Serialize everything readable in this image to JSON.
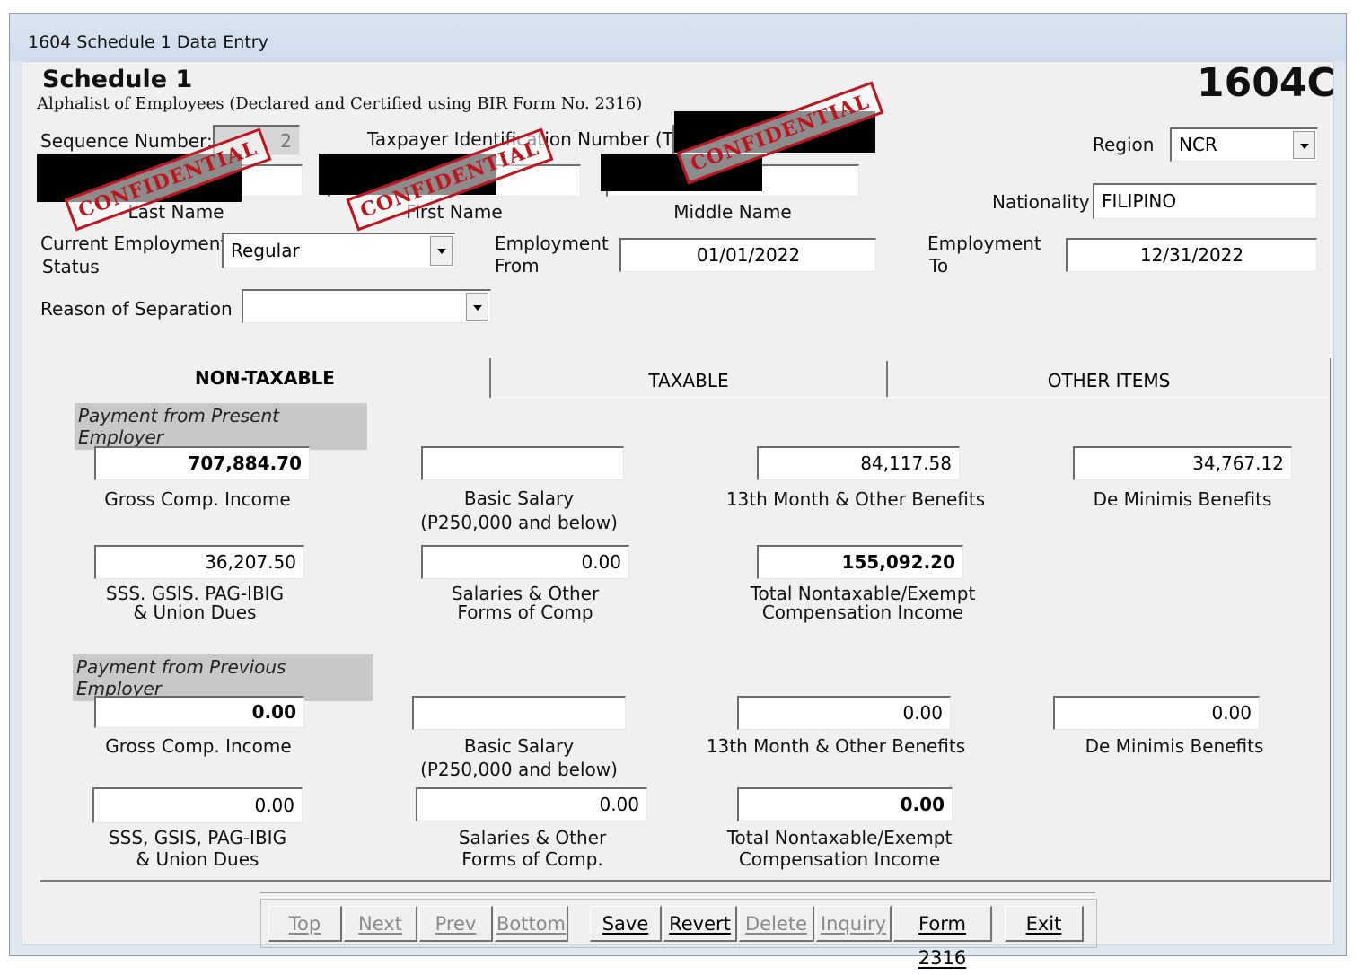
{
  "window": {
    "title": "1604 Schedule 1 Data Entry"
  },
  "header": {
    "title": "Schedule  1",
    "subtitle": "Alphalist of Employees (Declared and Certified using BIR Form No. 2316)",
    "form_code": "1604C"
  },
  "stamp_text": "CONFIDENTIAL",
  "fields": {
    "sequence_label": "Sequence Number:",
    "sequence_value": "2",
    "tin_label": "Taxpayer Identification Number (TIN):",
    "region_label": "Region",
    "region_value": "NCR",
    "nationality_label": "Nationality",
    "nationality_value": "FILIPINO",
    "last_name_label": "Last Name",
    "first_name_label": "First Name",
    "middle_name_label": "Middle Name",
    "employment_status_label_1": "Current Employment",
    "employment_status_label_2": "Status",
    "employment_status_value": "Regular",
    "employment_from_label_1": "Employment",
    "employment_from_label_2": "From",
    "employment_from_value": "01/01/2022",
    "employment_to_label_1": "Employment",
    "employment_to_label_2": "To",
    "employment_to_value": "12/31/2022",
    "reason_label": "Reason of Separation",
    "reason_value": ""
  },
  "tabs": [
    "NON-TAXABLE",
    "TAXABLE",
    "OTHER ITEMS"
  ],
  "present": {
    "section_title": "Payment from Present Employer",
    "gross_value": "707,884.70",
    "gross_label": "Gross Comp. Income",
    "basic_value": "",
    "basic_label_1": "Basic Salary",
    "basic_label_2": "(P250,000 and below)",
    "month13_value": "84,117.58",
    "month13_label": "13th Month &  Other Benefits",
    "deminimis_value": "34,767.12",
    "deminimis_label": "De Minimis Benefits",
    "sss_value": "36,207.50",
    "sss_label_1": "SSS. GSIS. PAG-IBIG",
    "sss_label_2": "& Union Dues",
    "salaries_value": "0.00",
    "salaries_label_1": "Salaries & Other",
    "salaries_label_2": "Forms of Comp",
    "total_value": "155,092.20",
    "total_label_1": "Total Nontaxable/Exempt",
    "total_label_2": "Compensation Income"
  },
  "previous": {
    "section_title": "Payment from Previous Employer",
    "gross_value": "0.00",
    "gross_label": "Gross Comp. Income",
    "basic_value": "",
    "basic_label_1": "Basic Salary",
    "basic_label_2": "(P250,000 and below)",
    "month13_value": "0.00",
    "month13_label": "13th Month &  Other Benefits",
    "deminimis_value": "0.00",
    "deminimis_label": "De Minimis Benefits",
    "sss_value": "0.00",
    "sss_label_1": "SSS, GSIS, PAG-IBIG",
    "sss_label_2": "& Union Dues",
    "salaries_value": "0.00",
    "salaries_label_1": "Salaries & Other",
    "salaries_label_2": "Forms of Comp.",
    "total_value": "0.00",
    "total_label_1": "Total Nontaxable/Exempt",
    "total_label_2": "Compensation Income"
  },
  "buttons": {
    "top": "Top",
    "next": "Next",
    "prev": "Prev",
    "bottom": "Bottom",
    "save": "Save",
    "revert": "Revert",
    "delete": "Delete",
    "inquiry": "Inquiry",
    "form2316": "Form 2316",
    "exit": "Exit"
  }
}
